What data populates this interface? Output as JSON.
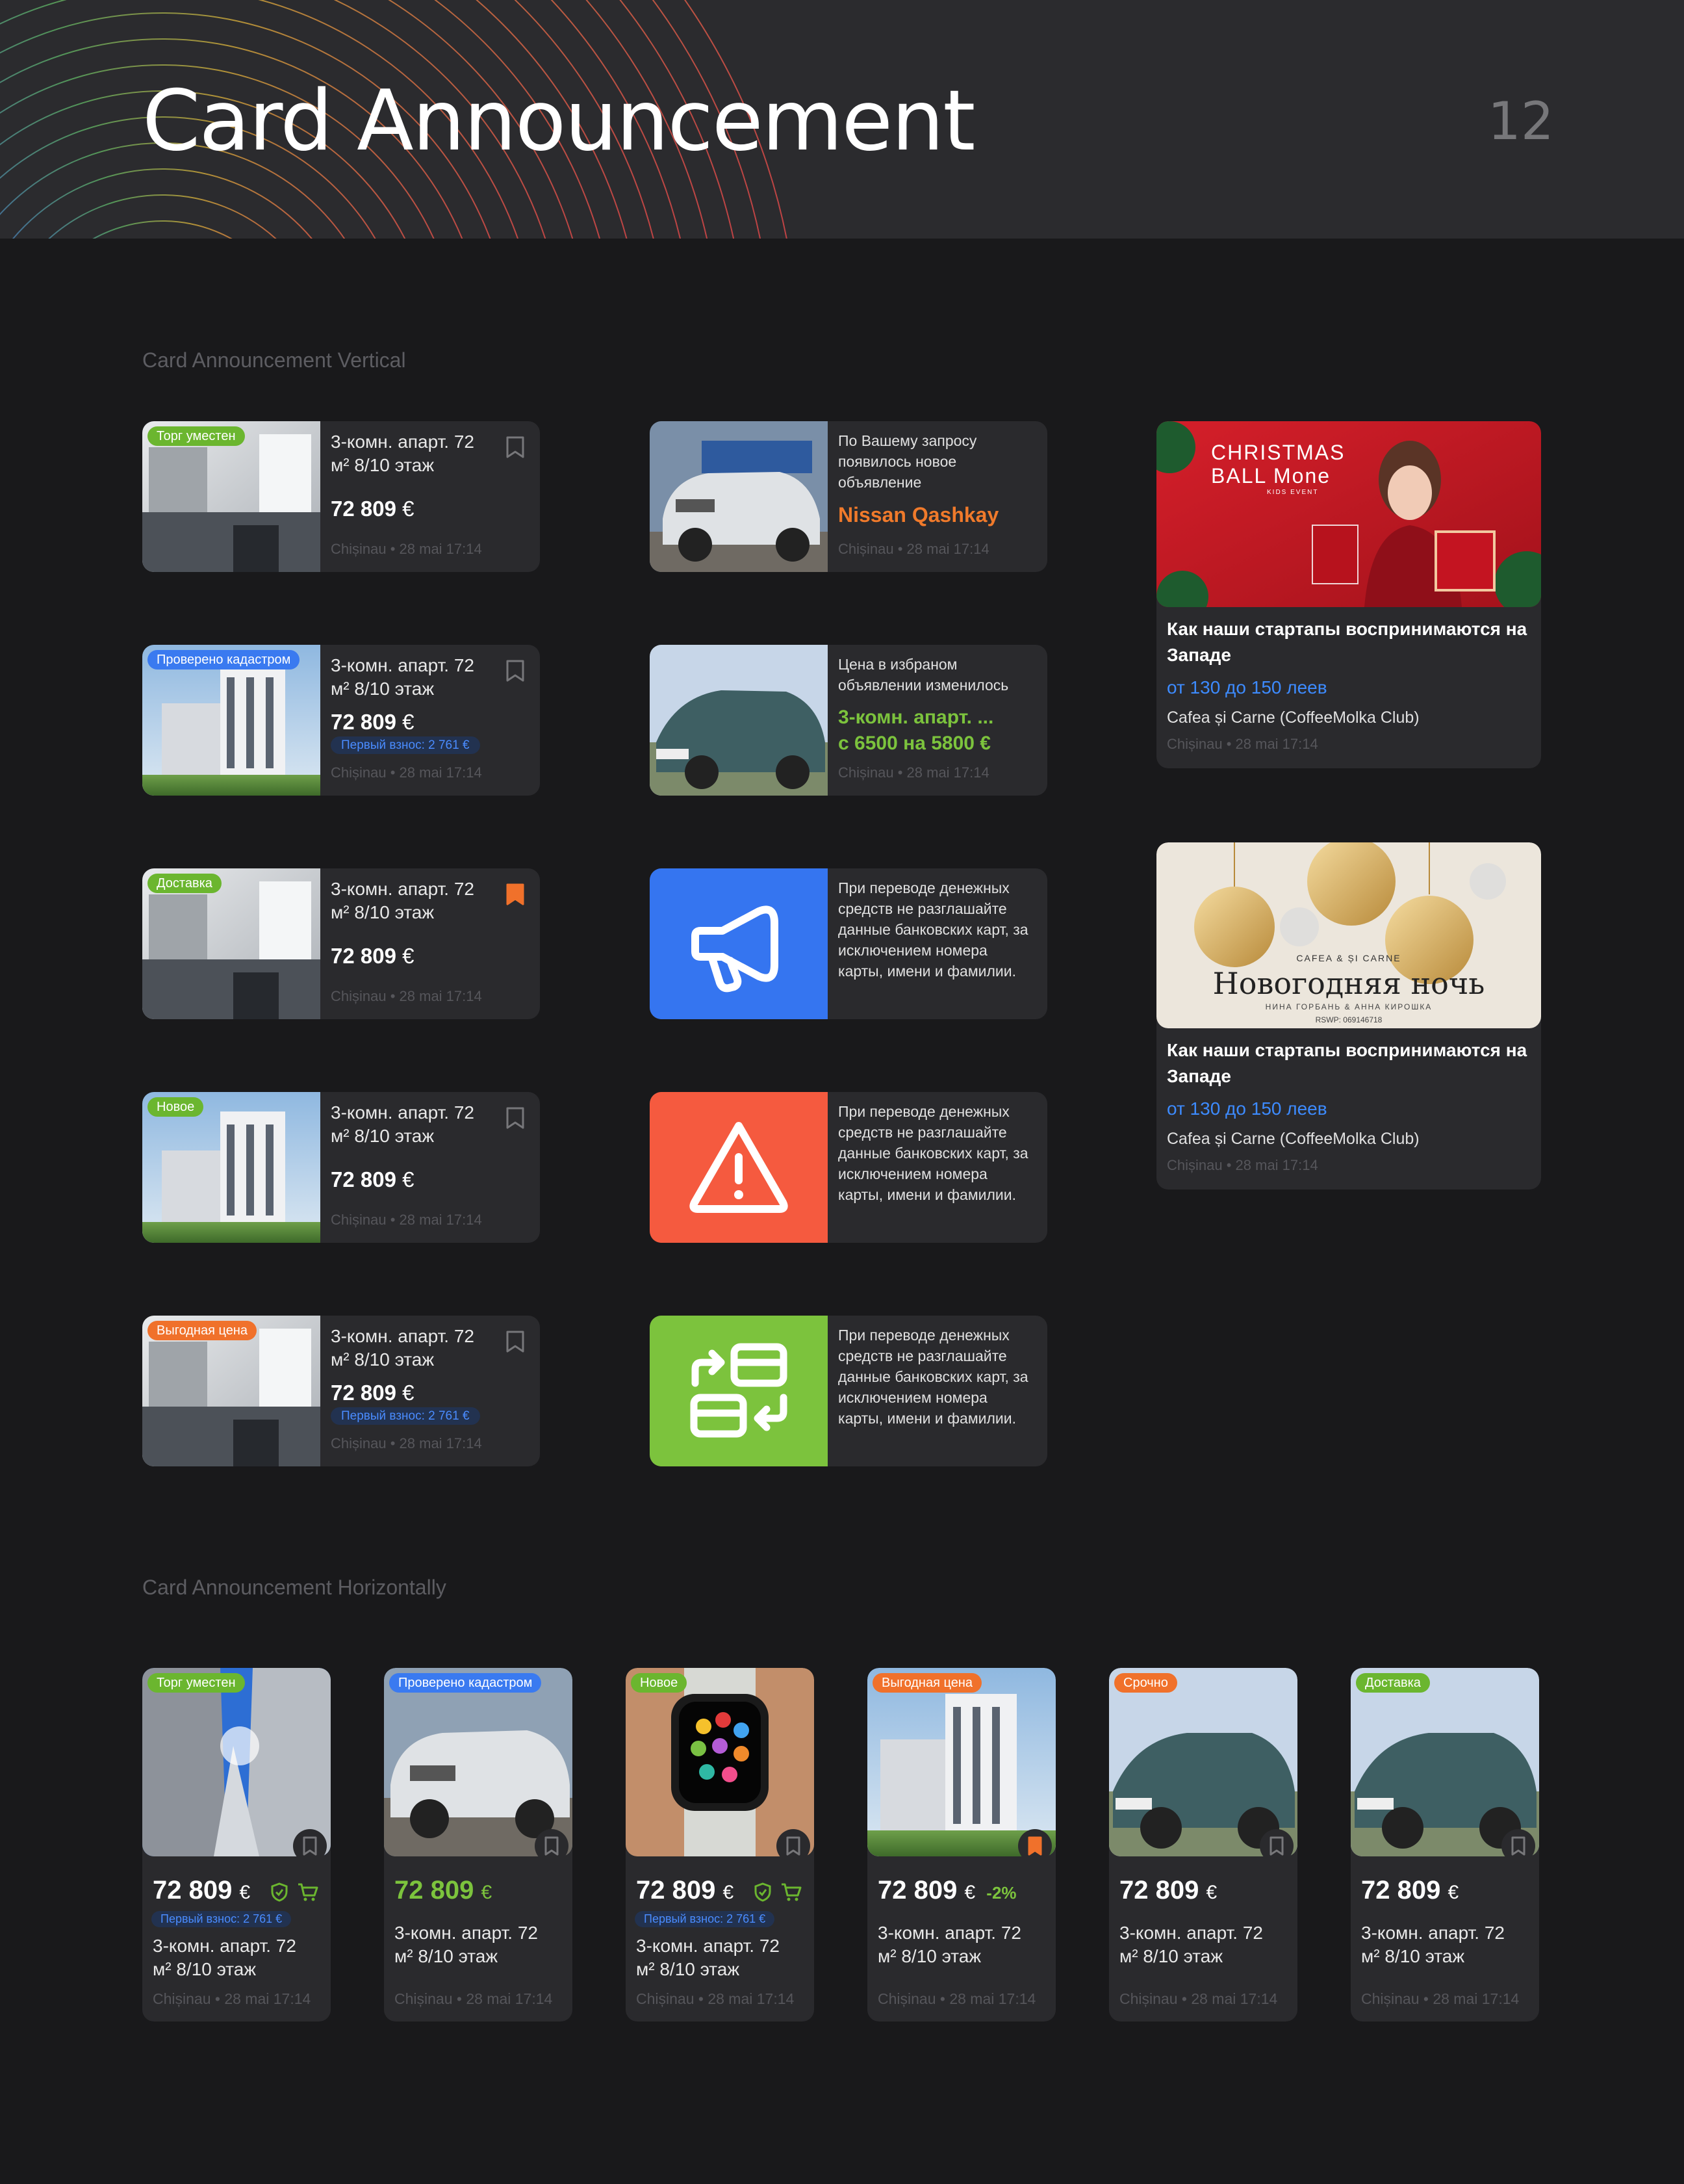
{
  "header": {
    "title": "Card Announcement",
    "page_number": "12"
  },
  "sections": {
    "vertical": "Card Announcement Vertical",
    "horizontal": "Card Announcement Horizontally"
  },
  "common": {
    "apt_title": "3-комн. апарт. 72 м² 8/10 этаж",
    "apt_title_line1": "3-комн. апарт. 72",
    "apt_title_line2": "м²   8/10 этаж",
    "price": "72 809",
    "currency": "€",
    "down_payment": "Первый взнос: 2 761 €",
    "meta": "Chișinau • 28 mai 17:14"
  },
  "vertical_cards": [
    {
      "badge": "Торг уместен"
    },
    {
      "badge": "Проверено кадастром"
    },
    {
      "badge": "Доставка"
    },
    {
      "badge": "Новое"
    },
    {
      "badge": "Выгодная цена"
    }
  ],
  "notifications": [
    {
      "text": "По Вашему запросу появилось новое объявление",
      "highlight": "Nissan Qashkay",
      "color": "#f07a2b"
    },
    {
      "text": "Цена в избраном объявлении изменилось",
      "highlight": "3-комн. апарт. ...",
      "highlight2": "с 6500 на 5800 €",
      "color": "#7cc33d"
    },
    {
      "text": "При переводе денежных средств не разглашайте данные банковских карт, за исключением номера карты, имени и фамилии.",
      "icon": "megaphone-icon",
      "color": "#3575f0"
    },
    {
      "text": "При переводе денежных средств не разглашайте данные банковских карт, за исключением номера карты, имени и фамилии.",
      "icon": "warning-icon",
      "color": "#f55a3f"
    },
    {
      "text": "При переводе денежных средств не разглашайте данные банковских карт, за исключением номера карты, имени и фамилии.",
      "icon": "card-exchange-icon",
      "color": "#7cc33d"
    }
  ],
  "event_cards": [
    {
      "image_text_1": "CHRISTMAS",
      "image_text_2": "BALL Mone",
      "image_text_3": "KIDS EVENT",
      "title": "Как наши стартапы воспринимаются на Западе",
      "price": "от 130 до 150 леев",
      "venue": "Cafea și Carne (CoffeeMolka Club)"
    },
    {
      "image_text_1": "CAFEA & ȘI CARNE",
      "image_text_2": "Новогодняя ночь",
      "image_text_3": "НИНА ГОРБАНЬ & АННА КИРОШКА",
      "image_text_4": "RSWP: 069146718",
      "title": "Как наши стартапы воспринимаются на Западе",
      "price": "от 130 до 150 леев",
      "venue": "Cafea și Carne (CoffeeMolka Club)"
    }
  ],
  "horizontal_cards": [
    {
      "badge": "Торг уместен",
      "discount": ""
    },
    {
      "badge": "Проверено кадастром",
      "discount": ""
    },
    {
      "badge": "Новое",
      "discount": ""
    },
    {
      "badge": "Выгодная цена",
      "discount": "-2%"
    },
    {
      "badge": "Срочно",
      "discount": ""
    },
    {
      "badge": "Доставка",
      "discount": ""
    }
  ],
  "colors": {
    "green": "#6bb62f",
    "blue": "#3a7af0",
    "orange": "#f0712b",
    "bookmark_active": "#f0712b"
  }
}
